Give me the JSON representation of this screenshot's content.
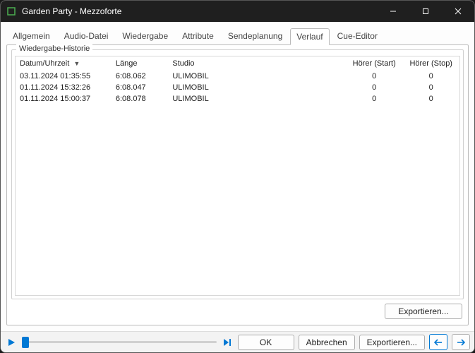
{
  "window": {
    "title": "Garden Party - Mezzoforte"
  },
  "tabs": [
    {
      "label": "Allgemein",
      "key": "allgemein"
    },
    {
      "label": "Audio-Datei",
      "key": "audio-datei"
    },
    {
      "label": "Wiedergabe",
      "key": "wiedergabe"
    },
    {
      "label": "Attribute",
      "key": "attribute"
    },
    {
      "label": "Sendeplanung",
      "key": "sendeplanung"
    },
    {
      "label": "Verlauf",
      "key": "verlauf"
    },
    {
      "label": "Cue-Editor",
      "key": "cue-editor"
    }
  ],
  "active_tab": "verlauf",
  "group": {
    "title": "Wiedergabe-Historie"
  },
  "table": {
    "headers": {
      "datum": "Datum/Uhrzeit",
      "laenge": "Länge",
      "studio": "Studio",
      "hstart": "Hörer (Start)",
      "hstop": "Hörer (Stop)"
    },
    "sort_indicator": "▼",
    "rows": [
      {
        "datum": "03.11.2024 01:35:55",
        "laenge": "6:08.062",
        "studio": "ULIMOBIL",
        "hstart": "0",
        "hstop": "0"
      },
      {
        "datum": "01.11.2024 15:32:26",
        "laenge": "6:08.047",
        "studio": "ULIMOBIL",
        "hstart": "0",
        "hstop": "0"
      },
      {
        "datum": "01.11.2024 15:00:37",
        "laenge": "6:08.078",
        "studio": "ULIMOBIL",
        "hstart": "0",
        "hstop": "0"
      }
    ]
  },
  "buttons": {
    "export": "Exportieren...",
    "ok": "OK",
    "cancel": "Abbrechen",
    "export2": "Exportieren..."
  },
  "icons": {
    "play": "play",
    "skip": "skip-end"
  },
  "colors": {
    "accent": "#0078d4"
  }
}
